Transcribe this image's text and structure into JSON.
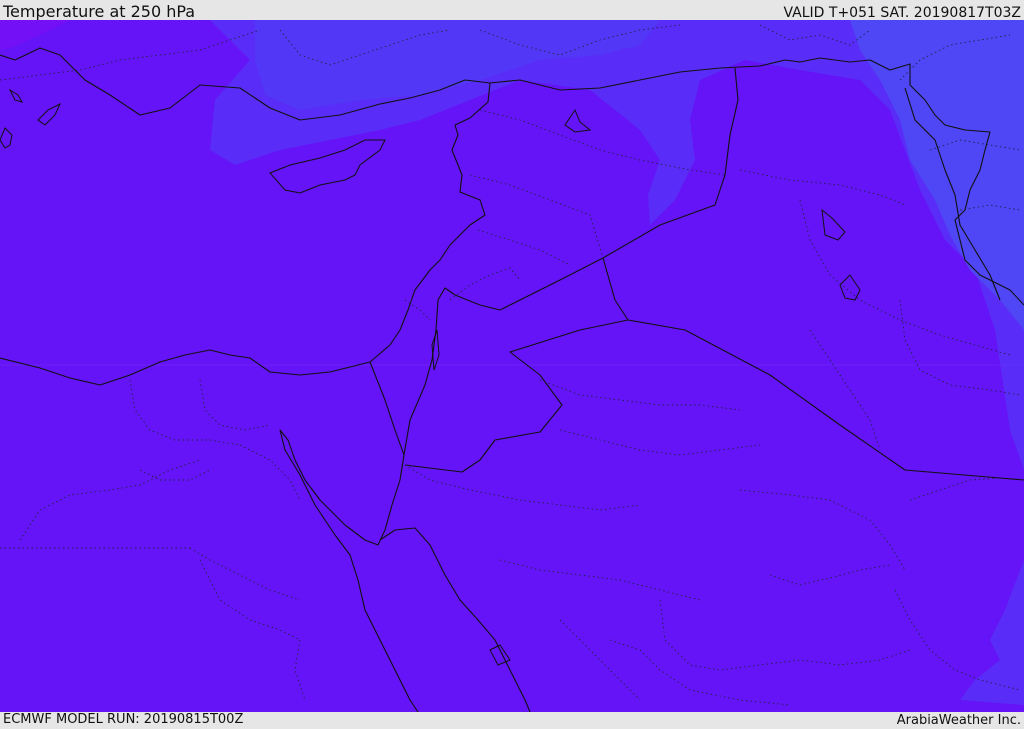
{
  "header": {
    "title": "Temperature at 250 hPa",
    "valid": "VALID T+051 SAT. 20190817T03Z"
  },
  "footer": {
    "model_run": "ECMWF MODEL RUN: 20190815T00Z",
    "credit": "ArabiaWeather Inc."
  },
  "map": {
    "field": "temperature",
    "level": "250 hPa",
    "colors": {
      "base": "#6514f7",
      "cooler": "#5a2cf7",
      "coolest": "#4f46f5",
      "border": "#111111",
      "coast": "#111111",
      "admin": "#222244"
    }
  }
}
